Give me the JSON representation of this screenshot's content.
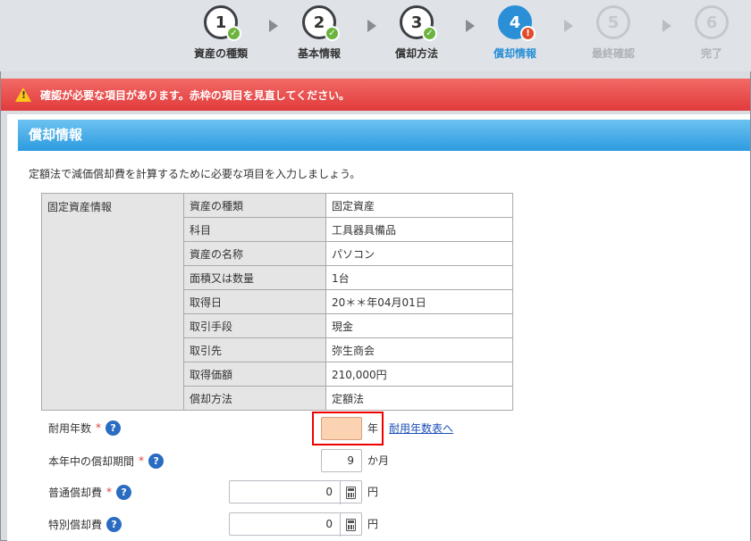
{
  "stepper": {
    "steps": [
      {
        "num": "1",
        "label": "資産の種類",
        "state": "done"
      },
      {
        "num": "2",
        "label": "基本情報",
        "state": "done"
      },
      {
        "num": "3",
        "label": "償却方法",
        "state": "done"
      },
      {
        "num": "4",
        "label": "償却情報",
        "state": "current"
      },
      {
        "num": "5",
        "label": "最終確認",
        "state": "todo"
      },
      {
        "num": "6",
        "label": "完了",
        "state": "todo"
      }
    ]
  },
  "alert": {
    "message": "確認が必要な項目があります。赤枠の項目を見直してください。",
    "color": "#e13b3c"
  },
  "panel": {
    "title": "償却情報",
    "intro": "定額法で減価償却費を計算するために必要な項目を入力しましょう。"
  },
  "asset_table": {
    "group_label": "固定資産情報",
    "rows": [
      {
        "key": "資産の種類",
        "value": "固定資産"
      },
      {
        "key": "科目",
        "value": "工具器具備品"
      },
      {
        "key": "資産の名称",
        "value": "パソコン"
      },
      {
        "key": "面積又は数量",
        "value": "1台"
      },
      {
        "key": "取得日",
        "value": "20＊＊年04月01日"
      },
      {
        "key": "取引手段",
        "value": "現金"
      },
      {
        "key": "取引先",
        "value": "弥生商会"
      },
      {
        "key": "取得価額",
        "value": "210,000円"
      },
      {
        "key": "償却方法",
        "value": "定額法"
      }
    ]
  },
  "form": {
    "useful_life": {
      "label": "耐用年数",
      "required": "*",
      "value": "",
      "unit": "年",
      "link": "耐用年数表へ"
    },
    "period": {
      "label": "本年中の償却期間",
      "required": "*",
      "value": "9",
      "unit": "か月"
    },
    "normal_dep": {
      "label": "普通償却費",
      "required": "*",
      "value": "0",
      "unit": "円"
    },
    "special_dep": {
      "label": "特別償却費",
      "value": "0",
      "unit": "円"
    },
    "help_glyph": "?"
  }
}
